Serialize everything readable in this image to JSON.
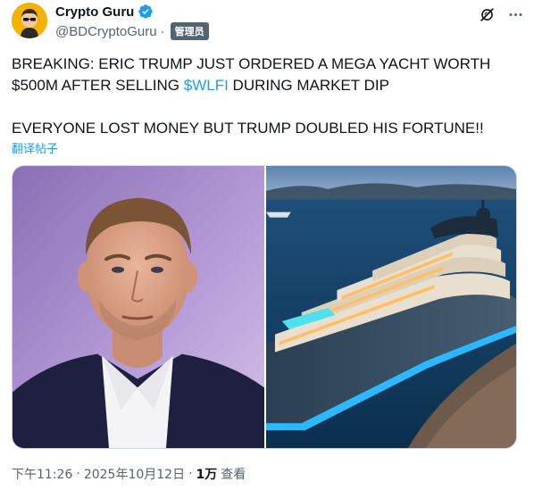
{
  "author": {
    "display_name": "Crypto Guru",
    "handle": "@BDCryptoGuru",
    "separator": "·",
    "badge": "管理员"
  },
  "icons": {
    "verified": "verified-badge-icon",
    "grok": "grok-icon",
    "more": "more-icon"
  },
  "tweet": {
    "line1": "BREAKING: ERIC TRUMP JUST ORDERED A MEGA YACHT WORTH",
    "line2_before": "$500M AFTER SELLING ",
    "cashtag": "$WLFI",
    "line2_after": " DURING MARKET DIP",
    "line3": "EVERYONE LOST MONEY BUT TRUMP DOUBLED HIS FORTUNE!!",
    "translate": "翻译帖子"
  },
  "footer": {
    "time": "下午11:26",
    "sep1": "·",
    "date": "2025年10月12日",
    "sep2": "·",
    "views_count": "1万",
    "views_label": "查看"
  },
  "colors": {
    "accent": "#1d9bf0",
    "verified": "#1d9bf0",
    "secondary_text": "#536471"
  }
}
